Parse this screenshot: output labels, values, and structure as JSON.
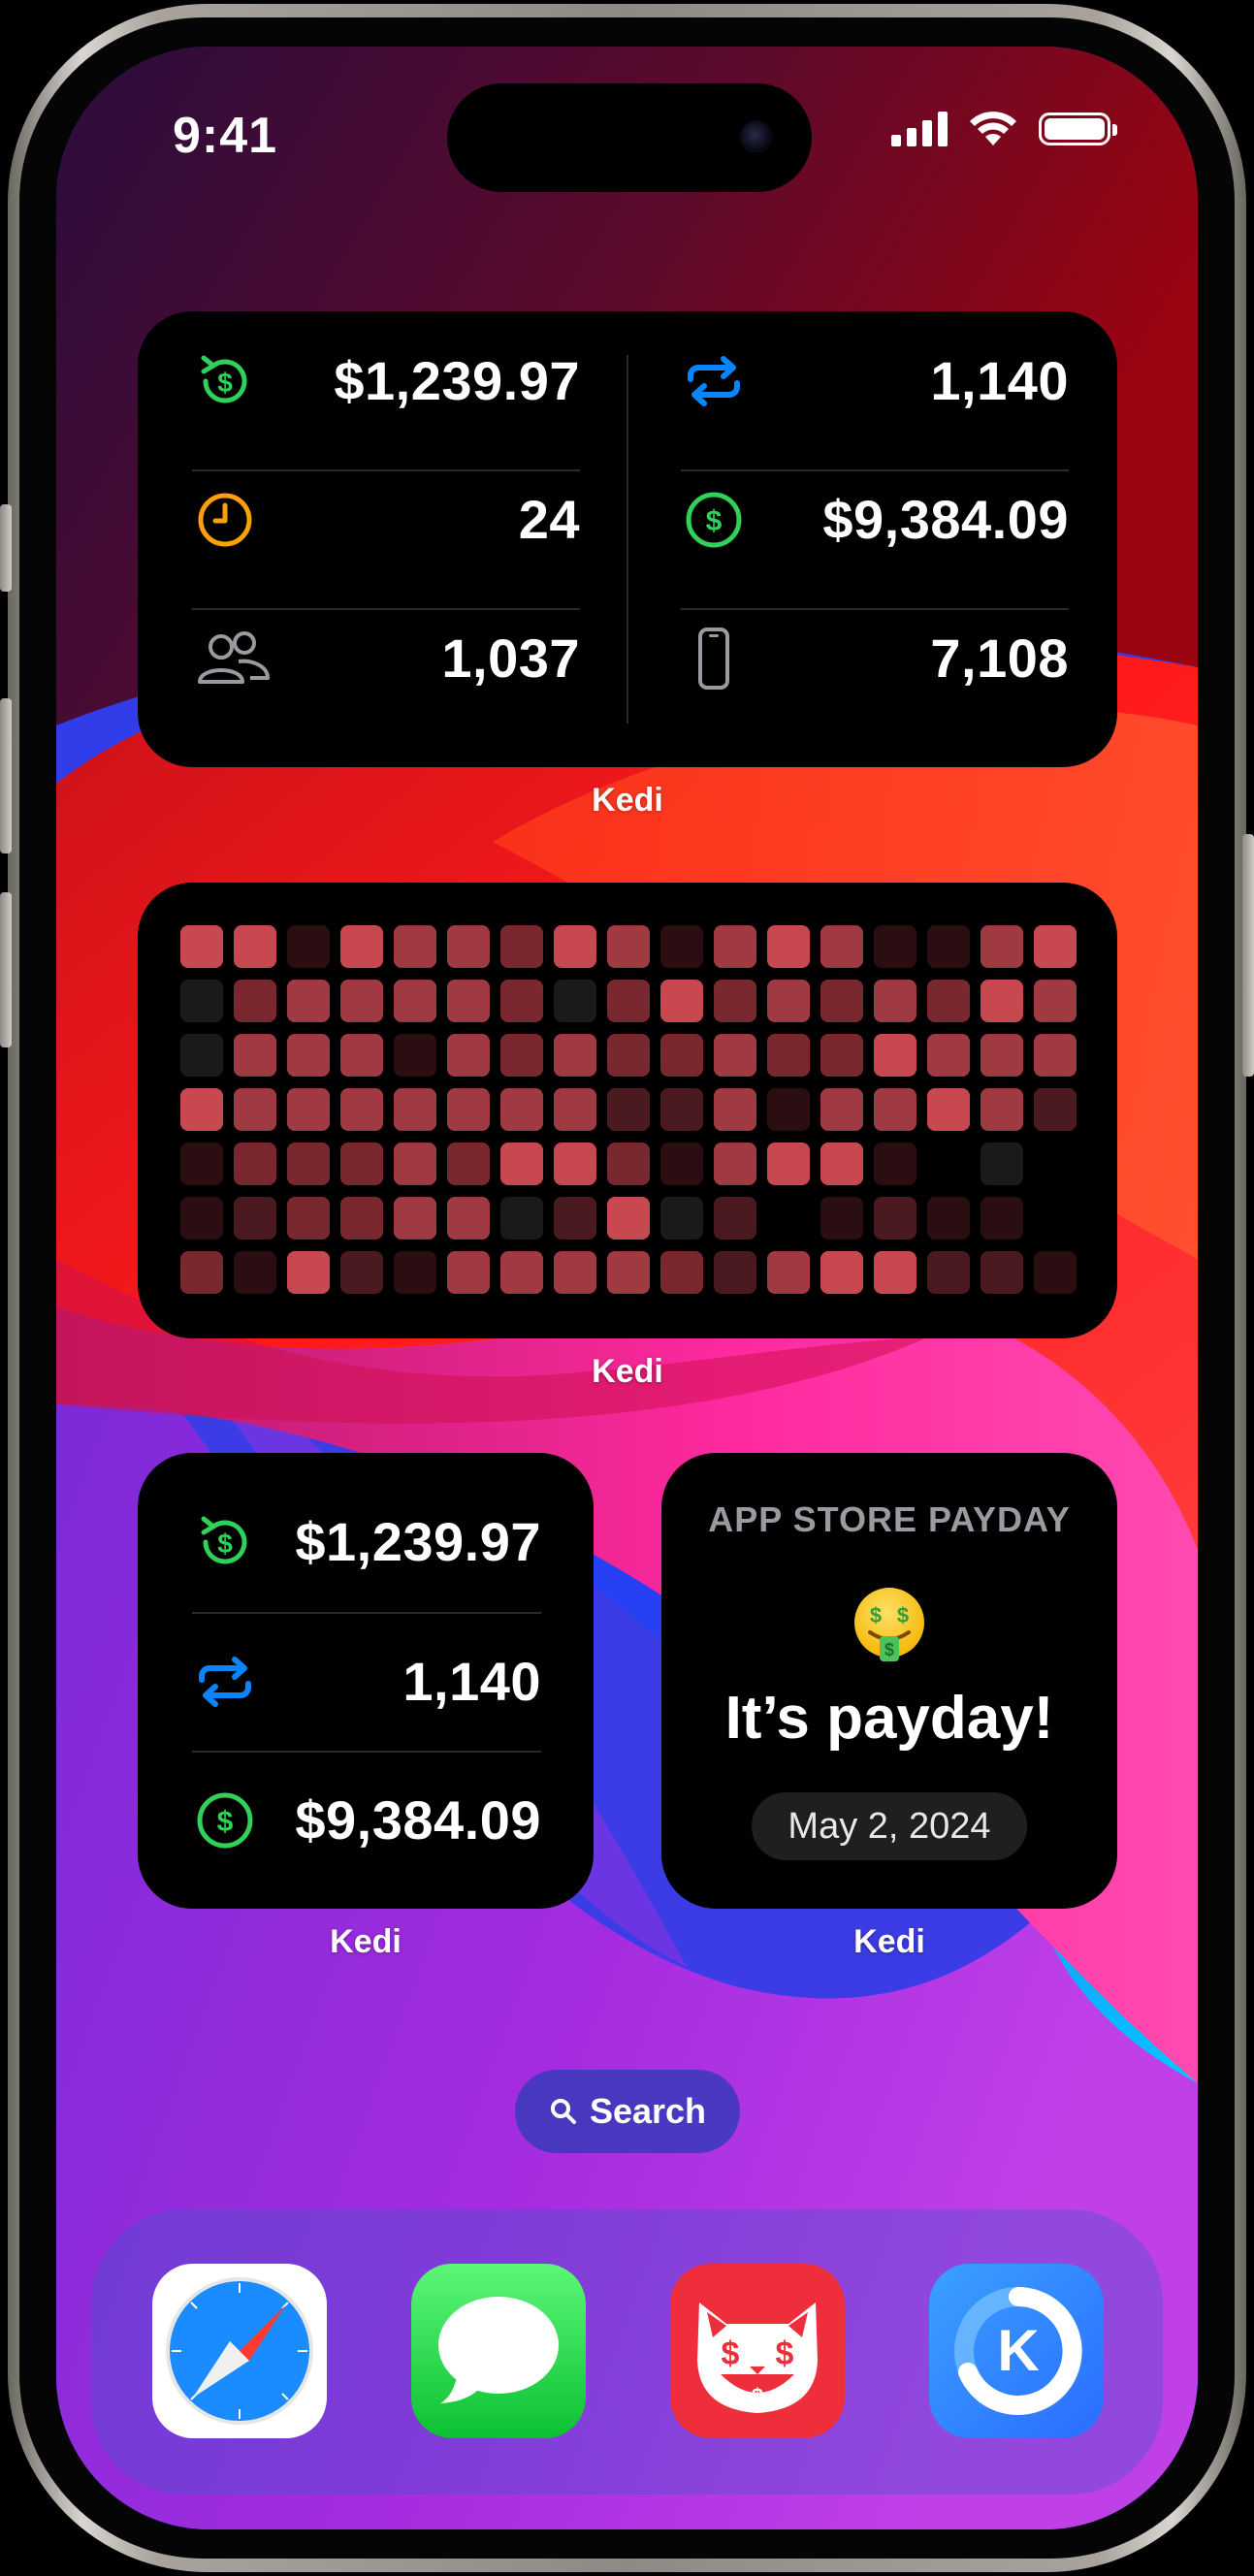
{
  "status_bar": {
    "time": "9:41"
  },
  "large_widget": {
    "left_column": [
      {
        "icon": "refund-dollar-icon",
        "value": "$1,239.97"
      },
      {
        "icon": "clock-icon",
        "value": "24"
      },
      {
        "icon": "users-icon",
        "value": "1,037"
      }
    ],
    "right_column": [
      {
        "icon": "renewal-arrows-icon",
        "value": "1,140"
      },
      {
        "icon": "dollar-circle-icon",
        "value": "$9,384.09"
      },
      {
        "icon": "phone-icon",
        "value": "7,108"
      }
    ],
    "label": "Kedi"
  },
  "heatmap_widget": {
    "label": "Kedi",
    "rows": 7,
    "columns": 17
  },
  "small_widget": {
    "rows": [
      {
        "icon": "refund-dollar-icon",
        "value": "$1,239.97"
      },
      {
        "icon": "renewal-arrows-icon",
        "value": "1,140"
      },
      {
        "icon": "dollar-circle-icon",
        "value": "$9,384.09"
      }
    ],
    "label": "Kedi"
  },
  "payday_widget": {
    "title": "APP STORE PAYDAY",
    "emoji": "money-mouth-face-icon",
    "headline": "It’s payday!",
    "date": "May 2, 2024",
    "label": "Kedi"
  },
  "search": {
    "label": "Search"
  },
  "dock": {
    "apps": [
      "safari-icon",
      "messages-icon",
      "kedi-cat-icon",
      "kedi-k-icon"
    ]
  },
  "colors": {
    "green": "#30d158",
    "orange": "#ff9f0a",
    "blue": "#0a84ff",
    "gray": "#9a9aa0"
  }
}
